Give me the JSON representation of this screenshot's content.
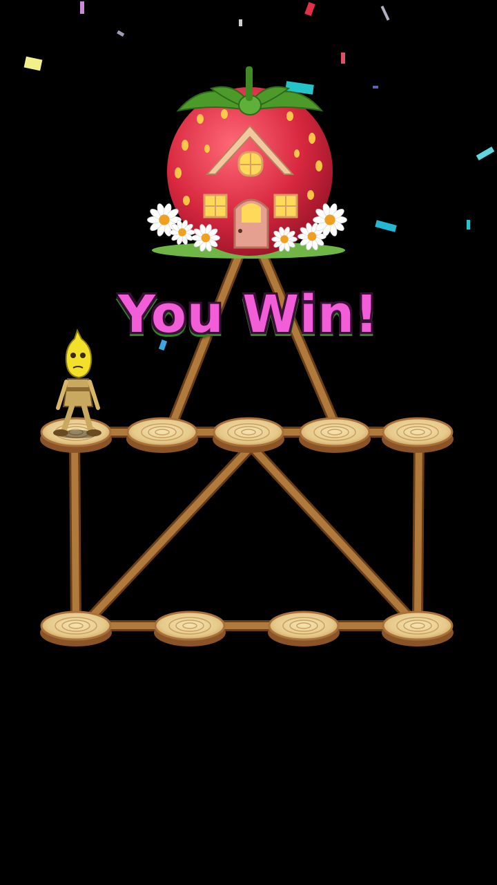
{
  "game": {
    "result_text": "You Win!",
    "goal": "strawberry-house",
    "player": "banana-character",
    "nodes_total": 9,
    "colors": {
      "background": "#000000",
      "win_text": "#f25ed8",
      "stick": "#a8713a",
      "stump_top": "#e9cf94",
      "strawberry": "#d8283f"
    }
  }
}
